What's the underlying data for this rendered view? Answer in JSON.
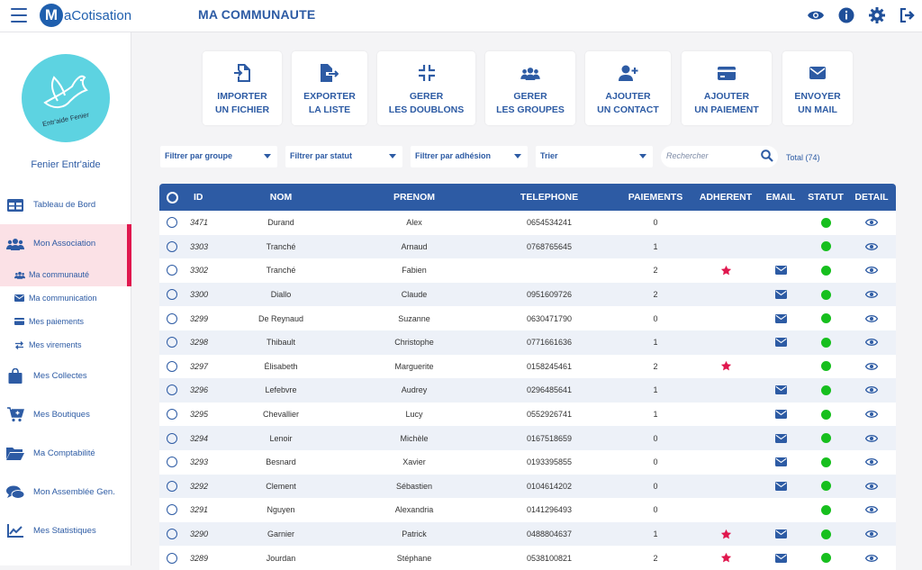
{
  "app": {
    "name": "aCotisation",
    "logo_letter": "M",
    "page_title": "MA COMMUNAUTE"
  },
  "topbar": {
    "icons": [
      "eye-icon",
      "info-icon",
      "gear-icon",
      "logout-icon"
    ]
  },
  "sidebar": {
    "org_name": "Fenier Entr'aide",
    "avatar_text": "Entr'aide Fenier",
    "items": [
      {
        "label": "Tableau de Bord",
        "icon": "dashboard-icon"
      },
      {
        "label": "Mon Association",
        "icon": "users-icon",
        "active": true
      },
      {
        "label": "Mes Collectes",
        "icon": "bag-icon"
      },
      {
        "label": "Mes Boutiques",
        "icon": "cart-icon"
      },
      {
        "label": "Ma Comptabilité",
        "icon": "folder-icon"
      },
      {
        "label": "Mon Assemblée Gen.",
        "icon": "chat-icon"
      },
      {
        "label": "Mes Statistiques",
        "icon": "chart-icon"
      }
    ],
    "subitems": [
      {
        "label": "Ma communauté",
        "icon": "users-icon",
        "active": true
      },
      {
        "label": "Ma communication",
        "icon": "mail-icon"
      },
      {
        "label": "Mes paiements",
        "icon": "card-icon"
      },
      {
        "label": "Mes virements",
        "icon": "transfer-icon"
      }
    ]
  },
  "actions": [
    {
      "label": "IMPORTER\nUN FICHIER",
      "icon": "import-icon"
    },
    {
      "label": "EXPORTER\nLA LISTE",
      "icon": "export-icon"
    },
    {
      "label": "GERER\nLES DOUBLONS",
      "icon": "compress-icon"
    },
    {
      "label": "GERER\nLES GROUPES",
      "icon": "group-icon"
    },
    {
      "label": "AJOUTER\nUN CONTACT",
      "icon": "add-user-icon"
    },
    {
      "label": "AJOUTER\nUN PAIEMENT",
      "icon": "card-icon"
    },
    {
      "label": "ENVOYER\nUN MAIL",
      "icon": "mail-icon"
    }
  ],
  "filters": {
    "group": "Filtrer par groupe",
    "status": "Filtrer par statut",
    "adhesion": "Filtrer par adhésion",
    "sort": "Trier",
    "search_placeholder": "Rechercher",
    "total": "Total (74)"
  },
  "table": {
    "headers": {
      "id": "ID",
      "nom": "NOM",
      "prenom": "PRENOM",
      "telephone": "TELEPHONE",
      "paiements": "PAIEMENTS",
      "adherent": "ADHERENT",
      "email": "EMAIL",
      "statut": "STATUT",
      "detail": "DETAIL"
    },
    "rows": [
      {
        "id": "3471",
        "nom": "Durand",
        "prenom": "Alex",
        "telephone": "0654534241",
        "paiements": "0",
        "adherent": false,
        "email": false,
        "statut": "active"
      },
      {
        "id": "3303",
        "nom": "Tranché",
        "prenom": "Arnaud",
        "telephone": "0768765645",
        "paiements": "1",
        "adherent": false,
        "email": false,
        "statut": "active"
      },
      {
        "id": "3302",
        "nom": "Tranché",
        "prenom": "Fabien",
        "telephone": "",
        "paiements": "2",
        "adherent": true,
        "email": true,
        "statut": "active"
      },
      {
        "id": "3300",
        "nom": "Diallo",
        "prenom": "Claude",
        "telephone": "0951609726",
        "paiements": "2",
        "adherent": false,
        "email": true,
        "statut": "active"
      },
      {
        "id": "3299",
        "nom": "De Reynaud",
        "prenom": "Suzanne",
        "telephone": "0630471790",
        "paiements": "0",
        "adherent": false,
        "email": true,
        "statut": "active"
      },
      {
        "id": "3298",
        "nom": "Thibault",
        "prenom": "Christophe",
        "telephone": "0771661636",
        "paiements": "1",
        "adherent": false,
        "email": true,
        "statut": "active"
      },
      {
        "id": "3297",
        "nom": "Élisabeth",
        "prenom": "Marguerite",
        "telephone": "0158245461",
        "paiements": "2",
        "adherent": true,
        "email": false,
        "statut": "active"
      },
      {
        "id": "3296",
        "nom": "Lefebvre",
        "prenom": "Audrey",
        "telephone": "0296485641",
        "paiements": "1",
        "adherent": false,
        "email": true,
        "statut": "active"
      },
      {
        "id": "3295",
        "nom": "Chevallier",
        "prenom": "Lucy",
        "telephone": "0552926741",
        "paiements": "1",
        "adherent": false,
        "email": true,
        "statut": "active"
      },
      {
        "id": "3294",
        "nom": "Lenoir",
        "prenom": "Michèle",
        "telephone": "0167518659",
        "paiements": "0",
        "adherent": false,
        "email": true,
        "statut": "active"
      },
      {
        "id": "3293",
        "nom": "Besnard",
        "prenom": "Xavier",
        "telephone": "0193395855",
        "paiements": "0",
        "adherent": false,
        "email": true,
        "statut": "active"
      },
      {
        "id": "3292",
        "nom": "Clement",
        "prenom": "Sébastien",
        "telephone": "0104614202",
        "paiements": "0",
        "adherent": false,
        "email": true,
        "statut": "active"
      },
      {
        "id": "3291",
        "nom": "Nguyen",
        "prenom": "Alexandria",
        "telephone": "0141296493",
        "paiements": "0",
        "adherent": false,
        "email": false,
        "statut": "active"
      },
      {
        "id": "3290",
        "nom": "Garnier",
        "prenom": "Patrick",
        "telephone": "0488804637",
        "paiements": "1",
        "adherent": true,
        "email": true,
        "statut": "active"
      },
      {
        "id": "3289",
        "nom": "Jourdan",
        "prenom": "Stéphane",
        "telephone": "0538100821",
        "paiements": "2",
        "adherent": true,
        "email": true,
        "statut": "active"
      }
    ]
  },
  "colors": {
    "primary": "#2d5ba4",
    "accent": "#e0174e",
    "status_ok": "#17bf1e",
    "star": "#e0174e"
  }
}
